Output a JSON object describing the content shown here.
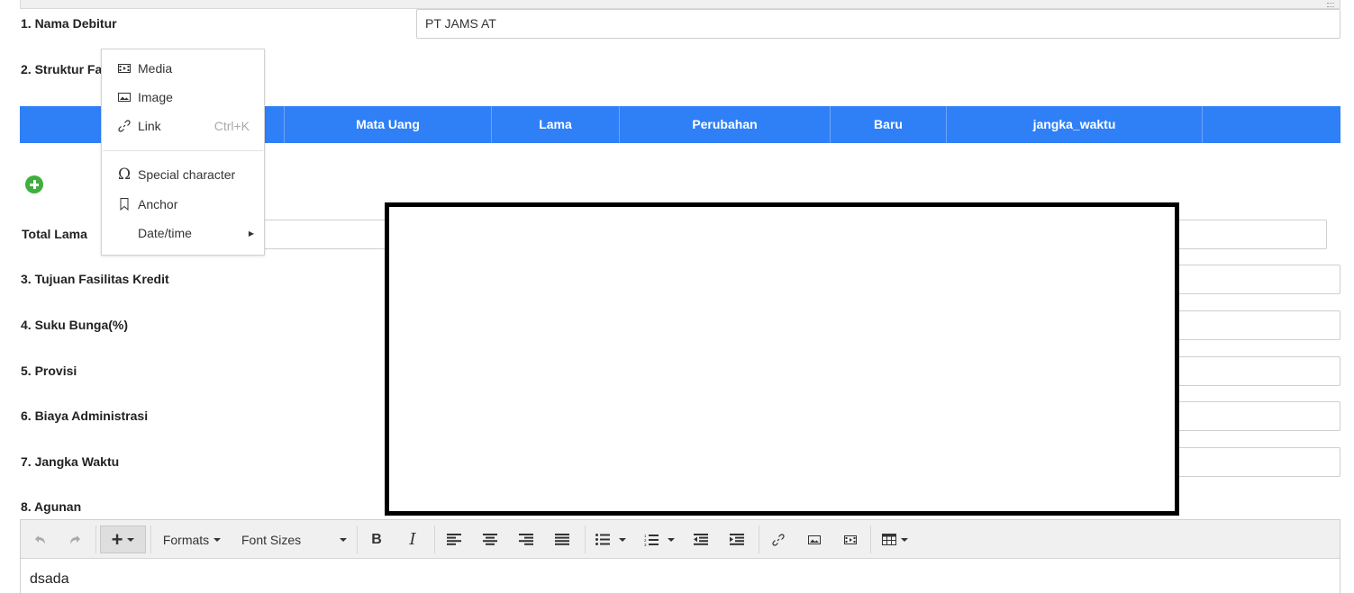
{
  "form": {
    "nama_debitur_label": "1. Nama Debitur",
    "nama_debitur_value": "PT JAMS AT",
    "struktur_label": "2. Struktur Fa",
    "total_lama_label": "Total Lama",
    "tujuan_label": "3. Tujuan Fasilitas Kredit",
    "suku_bunga_label": "4. Suku Bunga(%)",
    "provisi_label": "5. Provisi",
    "biaya_label": "6. Biaya Administrasi",
    "jangka_label": "7. Jangka Waktu",
    "agunan_label": "8. Agunan"
  },
  "table": {
    "columns": [
      "",
      "Mata Uang",
      "Lama",
      "Perubahan",
      "Baru",
      "jangka_waktu",
      ""
    ]
  },
  "insert_menu": {
    "items": [
      {
        "label": "Media",
        "icon": "media-icon",
        "shortcut": ""
      },
      {
        "label": "Image",
        "icon": "image-icon",
        "shortcut": ""
      },
      {
        "label": "Link",
        "icon": "link-icon",
        "shortcut": "Ctrl+K"
      },
      {
        "label": "Special character",
        "icon": "omega-icon",
        "shortcut": ""
      },
      {
        "label": "Anchor",
        "icon": "bookmark-icon",
        "shortcut": ""
      },
      {
        "label": "Date/time",
        "icon": "",
        "shortcut": "",
        "submenu": true
      }
    ]
  },
  "editor": {
    "toolbar": {
      "formats_label": "Formats",
      "font_sizes_label": "Font Sizes",
      "bold_label": "B",
      "italic_label": "I"
    },
    "content": "dsada"
  },
  "colors": {
    "table_header": "#2f80f7",
    "add_button": "#3fae3f",
    "toolbar_bg": "#f0f0f0"
  }
}
